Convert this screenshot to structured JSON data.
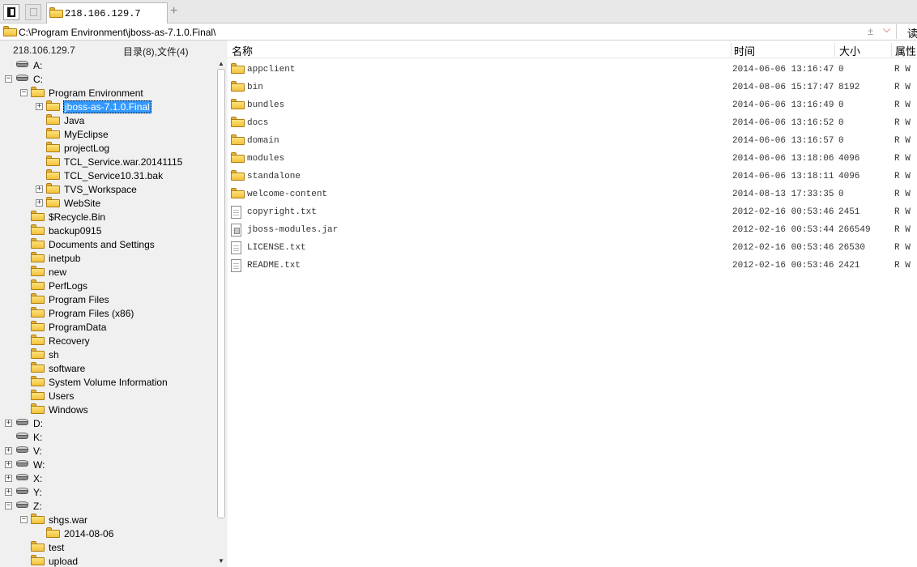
{
  "tab": {
    "title": "218.106.129.7",
    "new_tab_symbol": "+"
  },
  "address": {
    "path": "C:\\Program Environment\\jboss-as-7.1.0.Final\\",
    "sort_symbol": "±",
    "dropdown_symbol": "⌵",
    "read_label": "读"
  },
  "left_panel": {
    "host": "218.106.129.7",
    "summary": "目录(8),文件(4)"
  },
  "tree": [
    {
      "label": "A:",
      "type": "drive",
      "depth": 0,
      "expander": "",
      "selected": false
    },
    {
      "label": "C:",
      "type": "drive",
      "depth": 0,
      "expander": "−",
      "selected": false
    },
    {
      "label": "Program Environment",
      "type": "folder",
      "depth": 1,
      "expander": "−",
      "selected": false
    },
    {
      "label": "jboss-as-7.1.0.Final",
      "type": "folder",
      "depth": 2,
      "expander": "+",
      "selected": true
    },
    {
      "label": "Java",
      "type": "folder",
      "depth": 2,
      "expander": "",
      "selected": false
    },
    {
      "label": "MyEclipse",
      "type": "folder",
      "depth": 2,
      "expander": "",
      "selected": false
    },
    {
      "label": "projectLog",
      "type": "folder",
      "depth": 2,
      "expander": "",
      "selected": false
    },
    {
      "label": "TCL_Service.war.20141115",
      "type": "folder",
      "depth": 2,
      "expander": "",
      "selected": false
    },
    {
      "label": "TCL_Service10.31.bak",
      "type": "folder",
      "depth": 2,
      "expander": "",
      "selected": false
    },
    {
      "label": "TVS_Workspace",
      "type": "folder",
      "depth": 2,
      "expander": "+",
      "selected": false
    },
    {
      "label": "WebSite",
      "type": "folder",
      "depth": 2,
      "expander": "+",
      "selected": false
    },
    {
      "label": "$Recycle.Bin",
      "type": "folder",
      "depth": 1,
      "expander": "",
      "selected": false
    },
    {
      "label": "backup0915",
      "type": "folder",
      "depth": 1,
      "expander": "",
      "selected": false
    },
    {
      "label": "Documents and Settings",
      "type": "folder",
      "depth": 1,
      "expander": "",
      "selected": false
    },
    {
      "label": "inetpub",
      "type": "folder",
      "depth": 1,
      "expander": "",
      "selected": false
    },
    {
      "label": "new",
      "type": "folder",
      "depth": 1,
      "expander": "",
      "selected": false
    },
    {
      "label": "PerfLogs",
      "type": "folder",
      "depth": 1,
      "expander": "",
      "selected": false
    },
    {
      "label": "Program Files",
      "type": "folder",
      "depth": 1,
      "expander": "",
      "selected": false
    },
    {
      "label": "Program Files (x86)",
      "type": "folder",
      "depth": 1,
      "expander": "",
      "selected": false
    },
    {
      "label": "ProgramData",
      "type": "folder",
      "depth": 1,
      "expander": "",
      "selected": false
    },
    {
      "label": "Recovery",
      "type": "folder",
      "depth": 1,
      "expander": "",
      "selected": false
    },
    {
      "label": "sh",
      "type": "folder",
      "depth": 1,
      "expander": "",
      "selected": false
    },
    {
      "label": "software",
      "type": "folder",
      "depth": 1,
      "expander": "",
      "selected": false
    },
    {
      "label": "System Volume Information",
      "type": "folder",
      "depth": 1,
      "expander": "",
      "selected": false
    },
    {
      "label": "Users",
      "type": "folder",
      "depth": 1,
      "expander": "",
      "selected": false
    },
    {
      "label": "Windows",
      "type": "folder",
      "depth": 1,
      "expander": "",
      "selected": false
    },
    {
      "label": "D:",
      "type": "drive",
      "depth": 0,
      "expander": "+",
      "selected": false
    },
    {
      "label": "K:",
      "type": "drive",
      "depth": 0,
      "expander": "",
      "selected": false
    },
    {
      "label": "V:",
      "type": "drive",
      "depth": 0,
      "expander": "+",
      "selected": false
    },
    {
      "label": "W:",
      "type": "drive",
      "depth": 0,
      "expander": "+",
      "selected": false
    },
    {
      "label": "X:",
      "type": "drive",
      "depth": 0,
      "expander": "+",
      "selected": false
    },
    {
      "label": "Y:",
      "type": "drive",
      "depth": 0,
      "expander": "+",
      "selected": false
    },
    {
      "label": "Z:",
      "type": "drive",
      "depth": 0,
      "expander": "−",
      "selected": false
    },
    {
      "label": "shgs.war",
      "type": "folder",
      "depth": 1,
      "expander": "−",
      "selected": false
    },
    {
      "label": "2014-08-06",
      "type": "folder",
      "depth": 2,
      "expander": "",
      "selected": false
    },
    {
      "label": "test",
      "type": "folder",
      "depth": 1,
      "expander": "",
      "selected": false
    },
    {
      "label": "upload",
      "type": "folder",
      "depth": 1,
      "expander": "",
      "selected": false
    }
  ],
  "list": {
    "columns": {
      "name": "名称",
      "time": "时间",
      "size": "大小",
      "attr": "属性"
    },
    "rows": [
      {
        "name": "appclient",
        "type": "folder",
        "time": "2014-06-06 13:16:47",
        "size": "0",
        "attr": "R W"
      },
      {
        "name": "bin",
        "type": "folder",
        "time": "2014-08-06 15:17:47",
        "size": "8192",
        "attr": "R W"
      },
      {
        "name": "bundles",
        "type": "folder",
        "time": "2014-06-06 13:16:49",
        "size": "0",
        "attr": "R W"
      },
      {
        "name": "docs",
        "type": "folder",
        "time": "2014-06-06 13:16:52",
        "size": "0",
        "attr": "R W"
      },
      {
        "name": "domain",
        "type": "folder",
        "time": "2014-06-06 13:16:57",
        "size": "0",
        "attr": "R W"
      },
      {
        "name": "modules",
        "type": "folder",
        "time": "2014-06-06 13:18:06",
        "size": "4096",
        "attr": "R W"
      },
      {
        "name": "standalone",
        "type": "folder",
        "time": "2014-06-06 13:18:11",
        "size": "4096",
        "attr": "R W"
      },
      {
        "name": "welcome-content",
        "type": "folder",
        "time": "2014-08-13 17:33:35",
        "size": "0",
        "attr": "R W"
      },
      {
        "name": "copyright.txt",
        "type": "file",
        "time": "2012-02-16 00:53:46",
        "size": "2451",
        "attr": "R W"
      },
      {
        "name": "jboss-modules.jar",
        "type": "jar",
        "time": "2012-02-16 00:53:44",
        "size": "266549",
        "attr": "R W"
      },
      {
        "name": "LICENSE.txt",
        "type": "file",
        "time": "2012-02-16 00:53:46",
        "size": "26530",
        "attr": "R W"
      },
      {
        "name": "README.txt",
        "type": "file",
        "time": "2012-02-16 00:53:46",
        "size": "2421",
        "attr": "R W"
      }
    ]
  }
}
